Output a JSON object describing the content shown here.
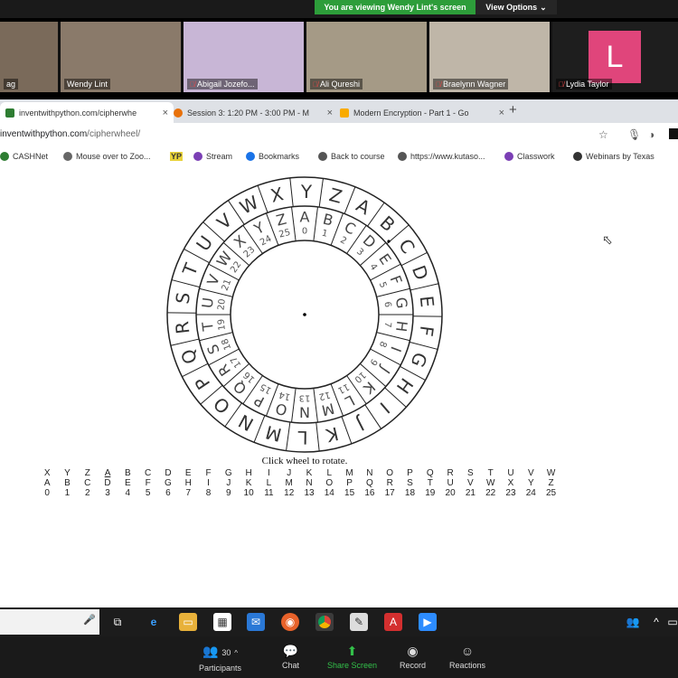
{
  "zoom": {
    "banner": "You are viewing Wendy Lint's screen",
    "view_options": "View Options",
    "participants": [
      {
        "name": "ag",
        "muted": false,
        "bg": "#7a6a5a"
      },
      {
        "name": "Wendy Lint",
        "muted": false,
        "bg": "#8a7a6a"
      },
      {
        "name": "Abigail Jozefo...",
        "muted": true,
        "bg": "#c8b6d6"
      },
      {
        "name": "Ali Qureshi",
        "muted": true,
        "bg": "#a59a86"
      },
      {
        "name": "Braelynn Wagner",
        "muted": true,
        "bg": "#bfb6a8"
      },
      {
        "name": "Lydia Taylor",
        "muted": true,
        "bg": "#1e1e1e",
        "initial": "L"
      }
    ],
    "controls": {
      "participants_label": "Participants",
      "participants_count": "30",
      "chat_label": "Chat",
      "share_label": "Share Screen",
      "record_label": "Record",
      "reactions_label": "Reactions"
    }
  },
  "browser": {
    "tabs": [
      {
        "title": "inventwithpython.com/cipherwhe",
        "color": "#2e7d32"
      },
      {
        "title": "Session 3: 1:20 PM - 3:00 PM - M",
        "color": "#e8710a"
      },
      {
        "title": "Modern Encryption - Part 1 - Go",
        "color": "#f9ab00"
      }
    ],
    "url_host": "inventwithpython.com",
    "url_path": "/cipherwheel/",
    "bookmarks": [
      "CASHNet",
      "Mouse over to Zoo...",
      "YP",
      "Stream",
      "Bookmarks",
      "Back to course",
      "https://www.kutaso...",
      "Classwork",
      "Webinars by Texas"
    ]
  },
  "page": {
    "caption": "Click wheel to rotate.",
    "outer_letters": [
      "A",
      "B",
      "C",
      "D",
      "E",
      "F",
      "G",
      "H",
      "I",
      "J",
      "K",
      "L",
      "M",
      "N",
      "O",
      "P",
      "Q",
      "R",
      "S",
      "T",
      "U",
      "V",
      "W",
      "X",
      "Y",
      "Z"
    ],
    "inner_letters": [
      "A",
      "B",
      "C",
      "D",
      "E",
      "F",
      "G",
      "H",
      "I",
      "J",
      "K",
      "L",
      "M",
      "N",
      "O",
      "P",
      "Q",
      "R",
      "S",
      "T",
      "U",
      "V",
      "W",
      "X",
      "Y",
      "Z"
    ],
    "inner_numbers": [
      "0",
      "1",
      "2",
      "3",
      "4",
      "5",
      "6",
      "7",
      "8",
      "9",
      "10",
      "11",
      "12",
      "13",
      "14",
      "15",
      "16",
      "17",
      "18",
      "19",
      "20",
      "21",
      "22",
      "23",
      "24",
      "25"
    ],
    "table": {
      "cipher_row": [
        "X",
        "Y",
        "Z",
        "A",
        "B",
        "C",
        "D",
        "E",
        "F",
        "G",
        "H",
        "I",
        "J",
        "K",
        "L",
        "M",
        "N",
        "O",
        "P",
        "Q",
        "R",
        "S",
        "T",
        "U",
        "V",
        "W"
      ],
      "plain_row": [
        "A",
        "B",
        "C",
        "D",
        "E",
        "F",
        "G",
        "H",
        "I",
        "J",
        "K",
        "L",
        "M",
        "N",
        "O",
        "P",
        "Q",
        "R",
        "S",
        "T",
        "U",
        "V",
        "W",
        "X",
        "Y",
        "Z"
      ],
      "number_row": [
        "0",
        "1",
        "2",
        "3",
        "4",
        "5",
        "6",
        "7",
        "8",
        "9",
        "10",
        "11",
        "12",
        "13",
        "14",
        "15",
        "16",
        "17",
        "18",
        "19",
        "20",
        "21",
        "22",
        "23",
        "24",
        "25"
      ]
    },
    "underlined_index": 3
  },
  "icons": {
    "star": "star-icon",
    "mic": "microphone-icon",
    "extension": "extension-icon"
  }
}
